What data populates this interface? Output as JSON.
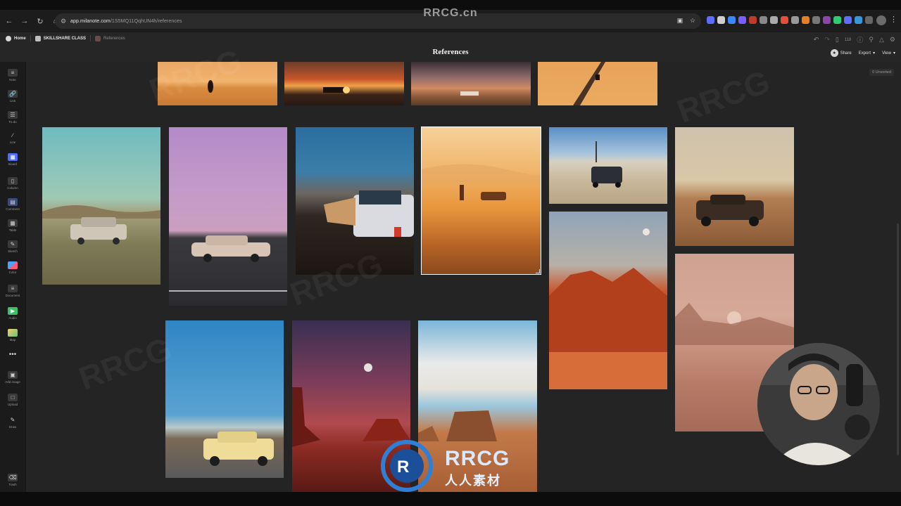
{
  "browser": {
    "url_host": "app.milanote.com",
    "url_path": "/1S5MQ11QqhUN4h/references"
  },
  "app": {
    "breadcrumbs": [
      {
        "label": "Home"
      },
      {
        "label": "SKILLSHARE CLASS"
      },
      {
        "label": "References"
      }
    ],
    "page_title": "References",
    "notification_count": "118",
    "actions": {
      "share_label": "Share",
      "export_label": "Export",
      "view_label": "View"
    },
    "unsorted_label": "0 Unsorted"
  },
  "toolbar": {
    "tools": [
      {
        "label": "Note",
        "icon": "note-icon"
      },
      {
        "label": "Link",
        "icon": "link-icon"
      },
      {
        "label": "To-do",
        "icon": "todo-icon"
      },
      {
        "label": "Line",
        "icon": "line-icon"
      },
      {
        "label": "Board",
        "icon": "board-icon"
      },
      {
        "label": "Column",
        "icon": "column-icon"
      },
      {
        "label": "Comment",
        "icon": "comment-icon"
      },
      {
        "label": "Table",
        "icon": "table-icon"
      },
      {
        "label": "Sketch",
        "icon": "sketch-icon"
      },
      {
        "label": "Color",
        "icon": "color-icon"
      },
      {
        "label": "Document",
        "icon": "document-icon"
      },
      {
        "label": "Audio",
        "icon": "audio-icon"
      },
      {
        "label": "Map",
        "icon": "map-icon"
      },
      {
        "label": "",
        "icon": "more-icon"
      },
      {
        "label": "Add image",
        "icon": "add-image-icon"
      },
      {
        "label": "Upload",
        "icon": "upload-icon"
      },
      {
        "label": "Draw",
        "icon": "draw-icon"
      }
    ],
    "trash_label": "Trash"
  },
  "watermark": {
    "top_text": "RRCG.cn",
    "logo_brand": "RRCG",
    "logo_sub": "人人素材"
  },
  "colors": {
    "canvas_bg": "#242424",
    "board_icon": "#4f6bff",
    "audio_icon": "#3fbf6a"
  }
}
